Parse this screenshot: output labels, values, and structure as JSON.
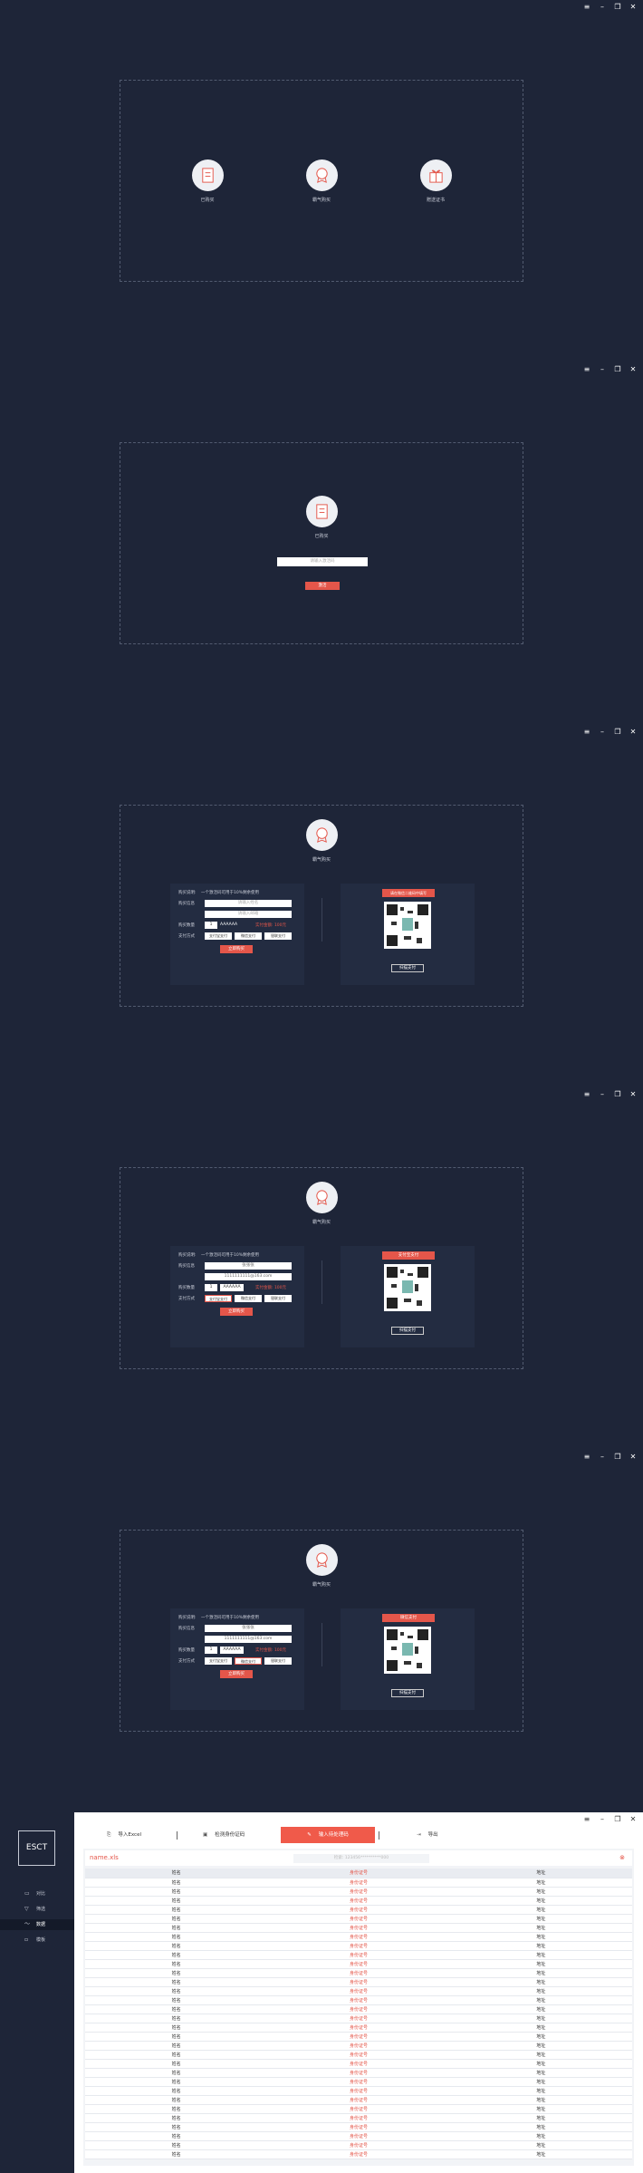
{
  "window_controls": [
    "≡",
    "–",
    "❐",
    "✕"
  ],
  "screen1": {
    "options": [
      {
        "label": "已购买",
        "icon": "doc-icon"
      },
      {
        "label": "霸气购买",
        "icon": "badge-icon"
      },
      {
        "label": "赠送证书",
        "icon": "gift-icon"
      }
    ]
  },
  "screen2": {
    "title": "已购买",
    "input_placeholder": "请输入激活码",
    "confirm": "激活"
  },
  "purchase": {
    "title": "霸气购买",
    "desc_label": "购买说明:",
    "desc_text": "一个激活码可用于10%剩余使用",
    "email_label": "购买信息",
    "name_placeholder": "请输入姓名",
    "email_placeholder": "请输入邮箱",
    "name_value": "张张张",
    "email_value": "1111111111@163.com",
    "qty_label": "购买数量",
    "qty_value": "1",
    "qty_unit": "AAAAAA",
    "price_note": "实付金额: 100元",
    "pay_label": "支付方式",
    "pay_methods": [
      "支付宝支付",
      "微信支付",
      "银联支付"
    ],
    "submit": "立即购买",
    "qr_hint_3": "请在微信二维码中填写",
    "qr_hint_4": "支付宝支付",
    "qr_hint_5": "微信支付",
    "scan_btn": "扫描支付"
  },
  "app": {
    "logo": "ESCT",
    "nav": [
      {
        "label": "对比",
        "icon": "▭"
      },
      {
        "label": "筛选",
        "icon": "▽"
      },
      {
        "label": "数据",
        "icon": "〜"
      },
      {
        "label": "模板",
        "icon": "▫"
      }
    ],
    "tabs": [
      "导入Excel",
      "检测身份证码",
      "输入待处理码",
      "导出"
    ],
    "file_name": "name.xls",
    "search_placeholder": "检索: 123456**********000",
    "close": "⊗",
    "columns": [
      "姓名",
      "身份证号",
      "地址"
    ],
    "rows": [
      [
        "姓名",
        "身份证号",
        "地址"
      ],
      [
        "姓名",
        "身份证号",
        "地址"
      ],
      [
        "姓名",
        "身份证号",
        "地址"
      ],
      [
        "姓名",
        "身份证号",
        "地址"
      ],
      [
        "姓名",
        "身份证号",
        "地址"
      ],
      [
        "姓名",
        "身份证号",
        "地址"
      ],
      [
        "姓名",
        "身份证号",
        "地址"
      ],
      [
        "姓名",
        "身份证号",
        "地址"
      ],
      [
        "姓名",
        "身份证号",
        "地址"
      ],
      [
        "姓名",
        "身份证号",
        "地址"
      ],
      [
        "姓名",
        "身份证号",
        "地址"
      ],
      [
        "姓名",
        "身份证号",
        "地址"
      ],
      [
        "姓名",
        "身份证号",
        "地址"
      ],
      [
        "姓名",
        "身份证号",
        "地址"
      ],
      [
        "姓名",
        "身份证号",
        "地址"
      ],
      [
        "姓名",
        "身份证号",
        "地址"
      ],
      [
        "姓名",
        "身份证号",
        "地址"
      ],
      [
        "姓名",
        "身份证号",
        "地址"
      ],
      [
        "姓名",
        "身份证号",
        "地址"
      ],
      [
        "姓名",
        "身份证号",
        "地址"
      ],
      [
        "姓名",
        "身份证号",
        "地址"
      ],
      [
        "姓名",
        "身份证号",
        "地址"
      ],
      [
        "姓名",
        "身份证号",
        "地址"
      ],
      [
        "姓名",
        "身份证号",
        "地址"
      ],
      [
        "姓名",
        "身份证号",
        "地址"
      ],
      [
        "姓名",
        "身份证号",
        "地址"
      ],
      [
        "姓名",
        "身份证号",
        "地址"
      ],
      [
        "姓名",
        "身份证号",
        "地址"
      ],
      [
        "姓名",
        "身份证号",
        "地址"
      ],
      [
        "姓名",
        "身份证号",
        "地址"
      ],
      [
        "姓名",
        "身份证号",
        "地址"
      ]
    ]
  },
  "colors": {
    "background": "#1e2538",
    "accent": "#e4564a",
    "panel": "#232c41"
  }
}
